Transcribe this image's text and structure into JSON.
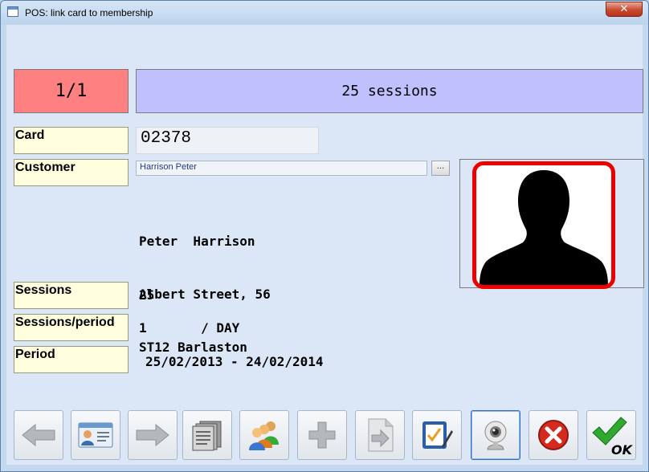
{
  "window": {
    "title": "POS: link card to membership",
    "close_label": "✕"
  },
  "counter": "1/1",
  "banner": "25 sessions",
  "labels": {
    "card": "Card",
    "customer": "Customer",
    "sessions": "Sessions",
    "sessions_period": "Sessions/period",
    "period": "Period"
  },
  "card_number": "02378",
  "customer_field": "Harrison Peter",
  "ellipsis_label": "...",
  "address": {
    "line1": "Peter  Harrison",
    "line2": "Albert Street, 56",
    "line3": "ST12 Barlaston"
  },
  "sessions_value": "25",
  "sessions_period_value": "1       / DAY",
  "period_value": "25/02/2013 - 24/02/2014",
  "ok_label": "OK",
  "toolbar_icons": [
    "arrow-left-icon",
    "id-card-icon",
    "arrow-right-icon",
    "documents-icon",
    "users-group-icon",
    "plus-icon",
    "document-arrow-icon",
    "checklist-pen-icon",
    "webcam-icon",
    "cancel-icon",
    "ok-check-icon"
  ],
  "colors": {
    "counter_bg": "#ff8080",
    "banner_bg": "#c0c0ff",
    "label_bg": "#ffffe0",
    "photo_border": "#ee0000"
  }
}
